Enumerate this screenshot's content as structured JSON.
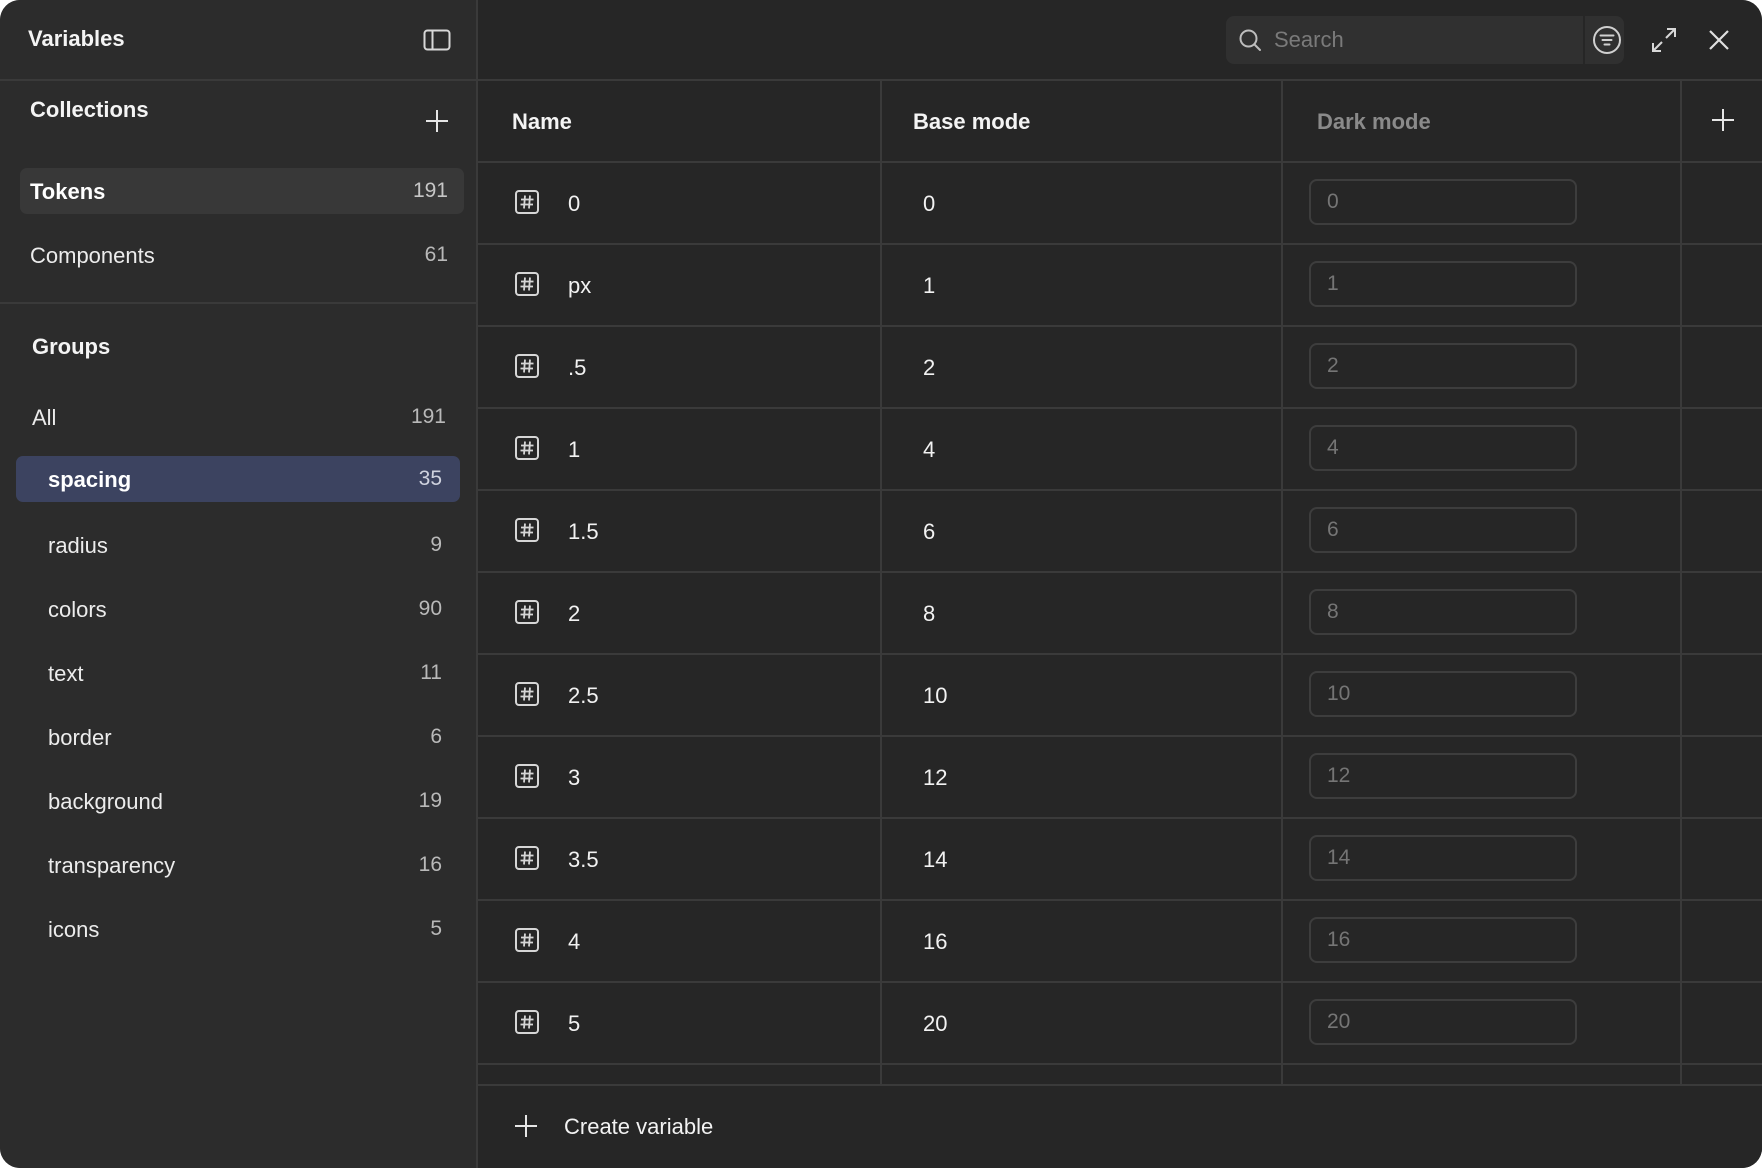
{
  "app": {
    "title": "Variables"
  },
  "collections": {
    "title": "Collections",
    "items": [
      {
        "label": "Tokens",
        "count": "191"
      },
      {
        "label": "Components",
        "count": "61"
      }
    ]
  },
  "groups": {
    "title": "Groups",
    "items": [
      {
        "label": "All",
        "count": "191"
      },
      {
        "label": "spacing",
        "count": "35"
      },
      {
        "label": "radius",
        "count": "9"
      },
      {
        "label": "colors",
        "count": "90"
      },
      {
        "label": "text",
        "count": "11"
      },
      {
        "label": "border",
        "count": "6"
      },
      {
        "label": "background",
        "count": "19"
      },
      {
        "label": "transparency",
        "count": "16"
      },
      {
        "label": "icons",
        "count": "5"
      }
    ]
  },
  "search": {
    "placeholder": "Search",
    "value": ""
  },
  "table": {
    "columns": {
      "name": "Name",
      "base": "Base mode",
      "dark": "Dark mode"
    },
    "rows": [
      {
        "name": "0",
        "base": "0",
        "dark": "0"
      },
      {
        "name": "px",
        "base": "1",
        "dark": "1"
      },
      {
        "name": ".5",
        "base": "2",
        "dark": "2"
      },
      {
        "name": "1",
        "base": "4",
        "dark": "4"
      },
      {
        "name": "1.5",
        "base": "6",
        "dark": "6"
      },
      {
        "name": "2",
        "base": "8",
        "dark": "8"
      },
      {
        "name": "2.5",
        "base": "10",
        "dark": "10"
      },
      {
        "name": "3",
        "base": "12",
        "dark": "12"
      },
      {
        "name": "3.5",
        "base": "14",
        "dark": "14"
      },
      {
        "name": "4",
        "base": "16",
        "dark": "16"
      },
      {
        "name": "5",
        "base": "20",
        "dark": "20"
      }
    ]
  },
  "footer": {
    "create_label": "Create variable"
  },
  "colors": {
    "window_bg": "#2a2a2a",
    "sidebar_bg": "#2c2c2c",
    "main_bg": "#262626",
    "selected_collection_bg": "#383838",
    "selected_group_bg": "#3c4360",
    "divider": "#3a3a3a",
    "text_primary": "#f2f2f2",
    "text_muted": "#7d7d7d"
  },
  "icons": {
    "panel_toggle": "sidebar-panel-icon",
    "add": "plus-icon",
    "search": "search-icon",
    "filter": "filter-icon",
    "expand": "expand-icon",
    "close": "close-icon",
    "number": "number-variable-icon"
  }
}
